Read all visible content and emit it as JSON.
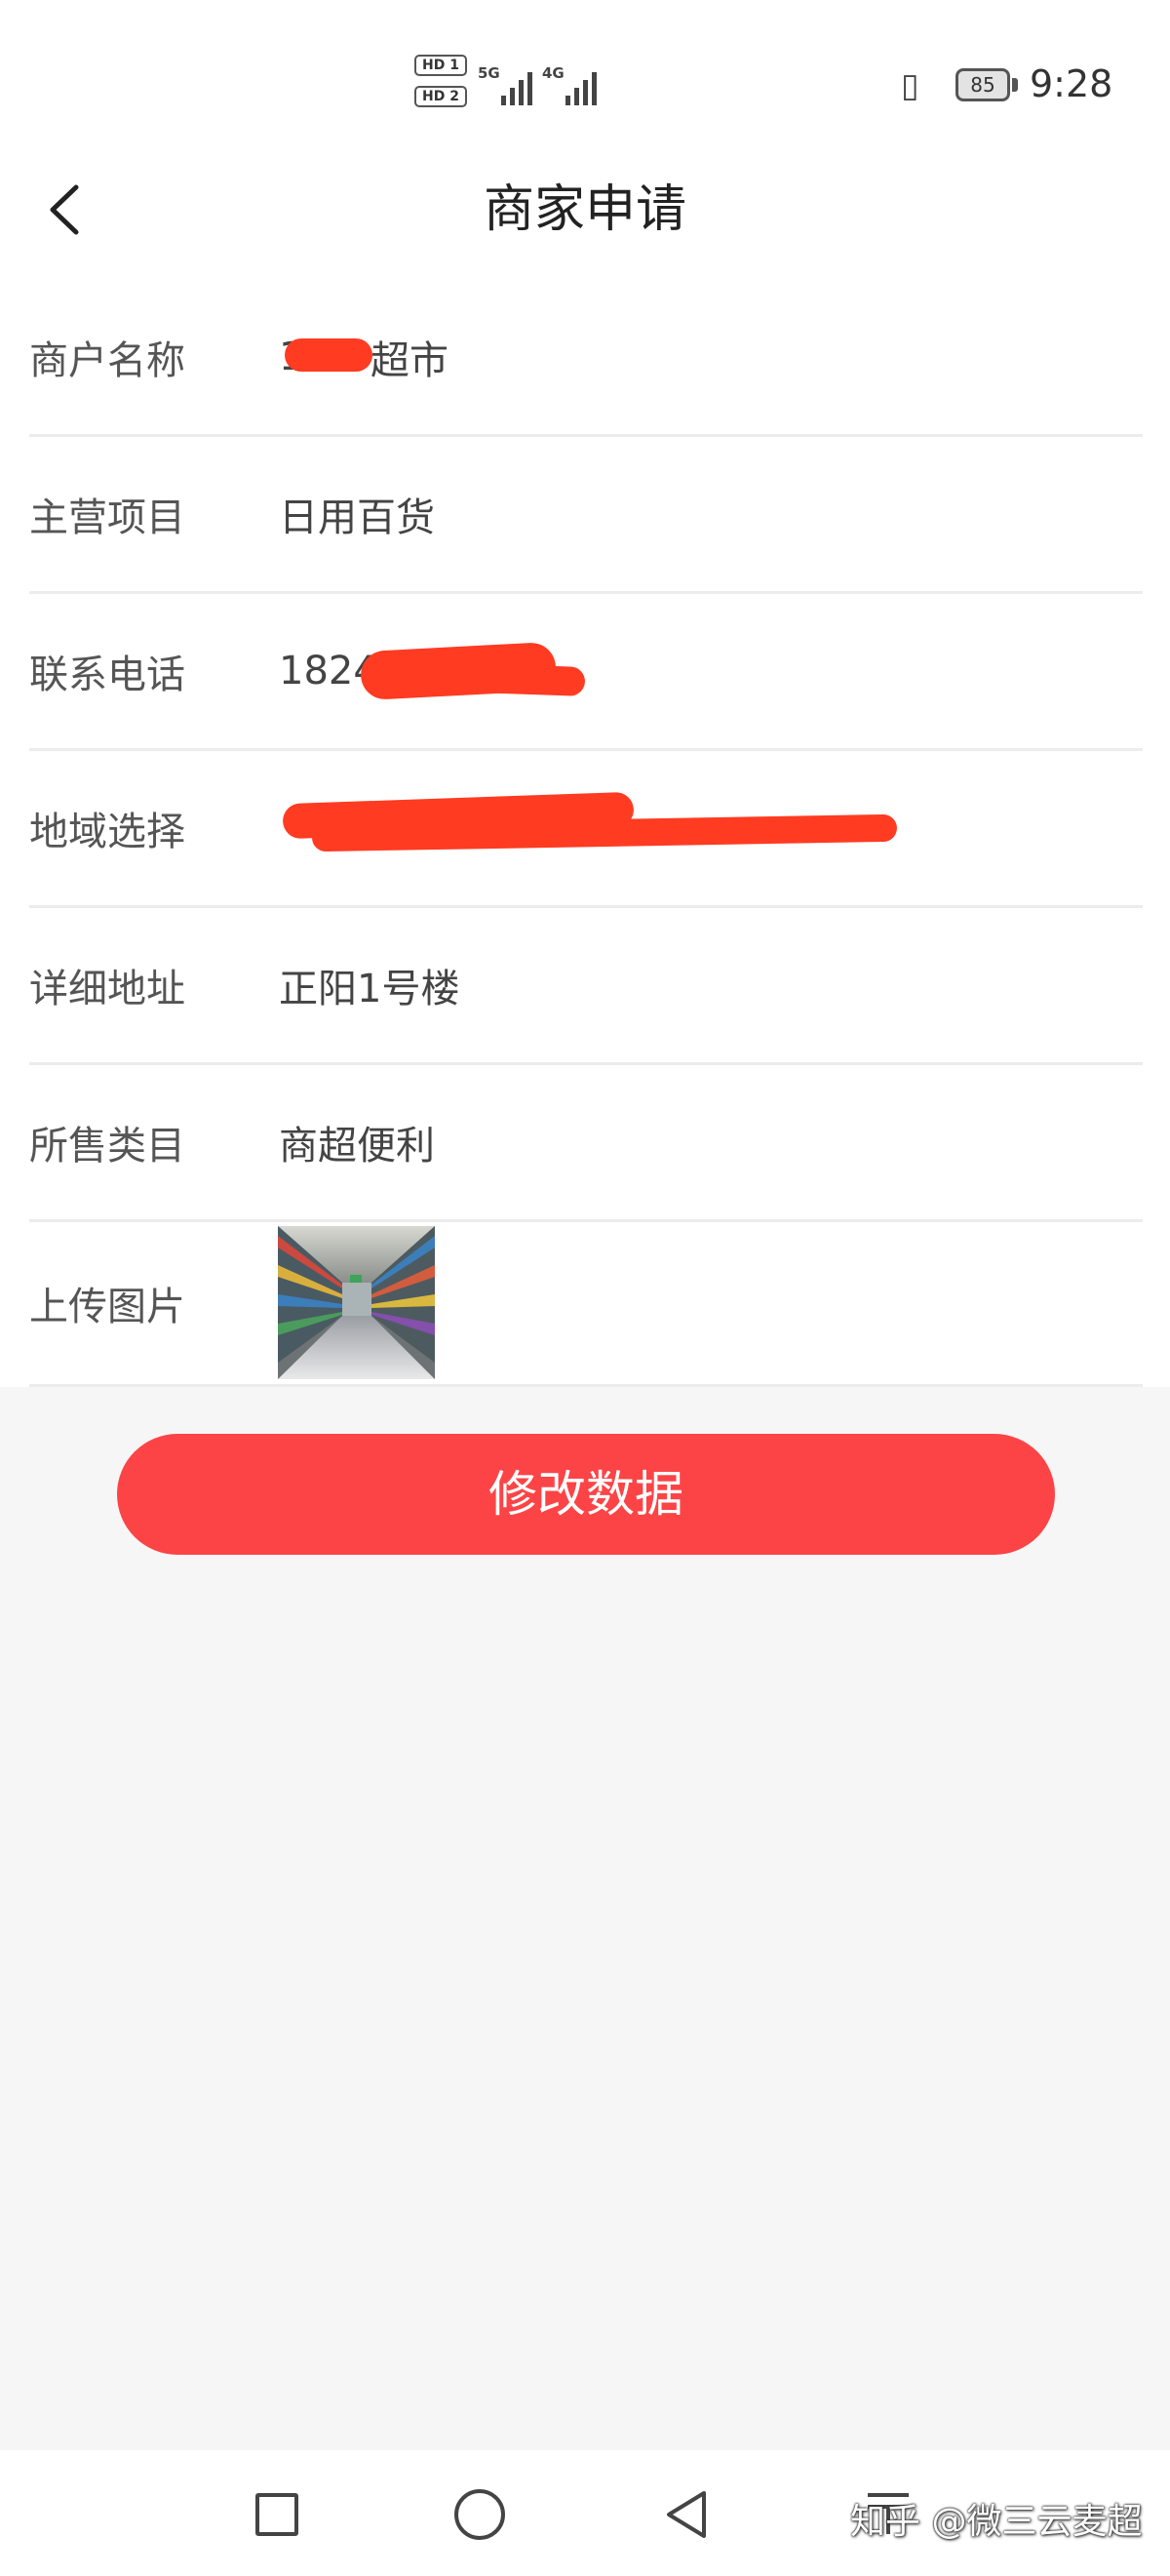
{
  "status_bar": {
    "sim1_badge": "HD 1",
    "sim2_badge": "HD 2",
    "network1": "5G",
    "network2": "4G",
    "battery": "85",
    "time": "9:28"
  },
  "header": {
    "title": "商家申请",
    "back_icon": "chevron-left-icon"
  },
  "form": {
    "rows": [
      {
        "label": "商户名称",
        "value": "超市",
        "value_prefix": "1",
        "redacted": true
      },
      {
        "label": "主营项目",
        "value": "日用百货",
        "redacted": false
      },
      {
        "label": "联系电话",
        "value": "1824",
        "redacted": true
      },
      {
        "label": "地域选择",
        "value": "",
        "redacted": true
      },
      {
        "label": "详细地址",
        "value": "正阳1号楼",
        "redacted": false
      },
      {
        "label": "所售类目",
        "value": "商超便利",
        "redacted": false
      },
      {
        "label": "上传图片",
        "value": "",
        "image": "supermarket-aisle-photo",
        "redacted": false
      }
    ]
  },
  "actions": {
    "submit_label": "修改数据"
  },
  "nav_bar": {
    "icons": [
      "recent-apps-icon",
      "home-icon",
      "back-icon",
      "menu-icon"
    ]
  },
  "watermark": "知乎 @微三云麦超",
  "colors": {
    "accent": "#fc4447",
    "redaction": "#ff3b22",
    "page_bg": "#f6f6f6",
    "card_bg": "#ffffff"
  }
}
